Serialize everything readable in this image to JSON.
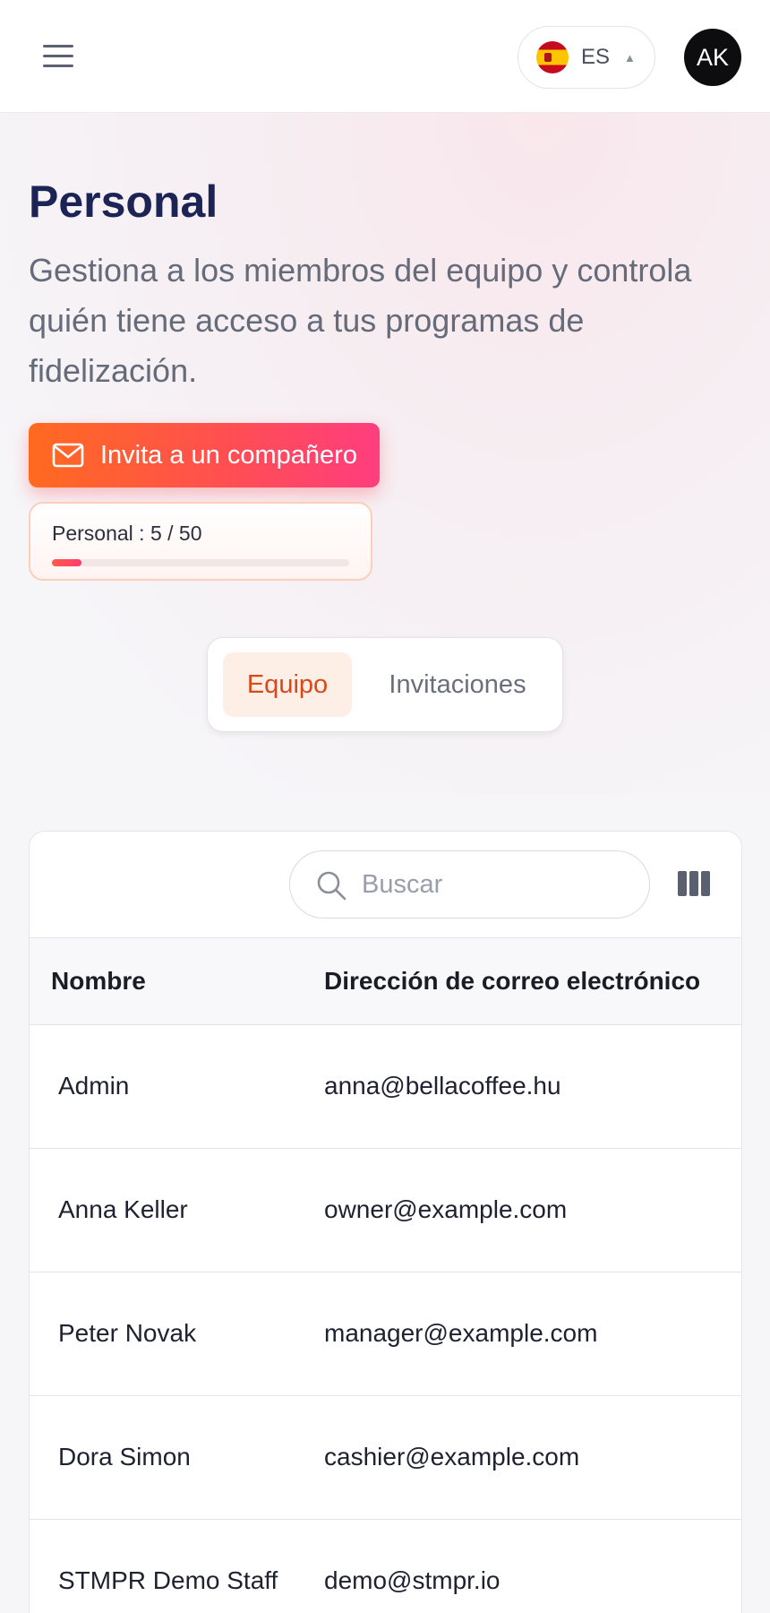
{
  "header": {
    "language_code": "ES",
    "language_flag": "spain-flag-icon",
    "avatar_initials": "AK"
  },
  "page": {
    "title": "Personal",
    "description": "Gestiona a los miembros del equipo y controla quién tiene acceso a tus programas de fidelización.",
    "invite_label": "Invita a un compañero",
    "quota_label": "Personal : 5 / 50",
    "quota_used": 5,
    "quota_total": 50
  },
  "tabs": [
    {
      "label": "Equipo",
      "active": true
    },
    {
      "label": "Invitaciones",
      "active": false
    }
  ],
  "table": {
    "search_placeholder": "Buscar",
    "columns": [
      "Nombre",
      "Dirección de correo electrónico"
    ],
    "rows": [
      {
        "name": "Admin",
        "email": "anna@bellacoffee.hu"
      },
      {
        "name": "Anna Keller",
        "email": "owner@example.com"
      },
      {
        "name": "Peter Novak",
        "email": "manager@example.com"
      },
      {
        "name": "Dora Simon",
        "email": "cashier@example.com"
      },
      {
        "name": "STMPR Demo Staff",
        "email": "demo@stmpr.io"
      }
    ]
  },
  "colors": {
    "accent_start": "#ff6a1f",
    "accent_end": "#ff3d7f",
    "title": "#1c2455",
    "active_tab_text": "#d9481a"
  }
}
